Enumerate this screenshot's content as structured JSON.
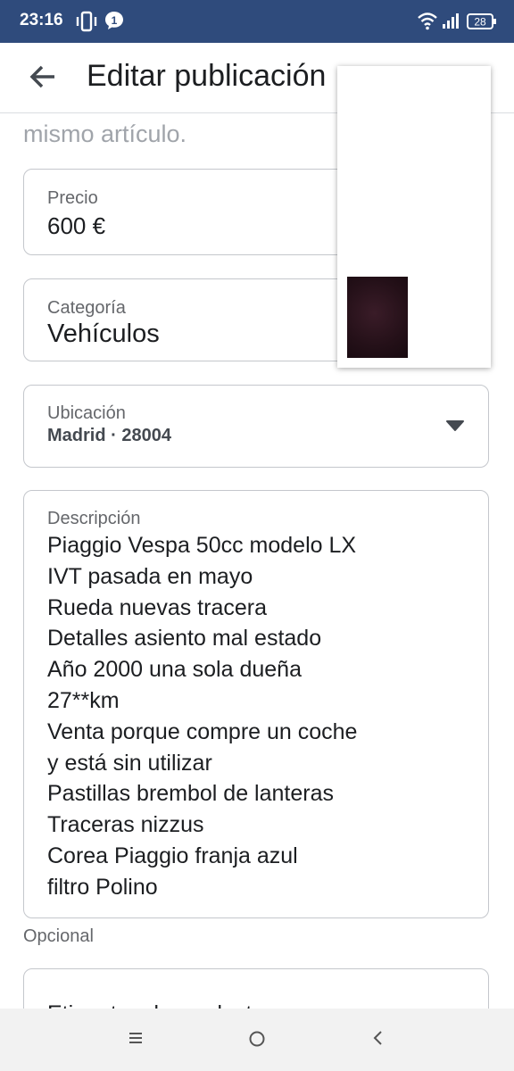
{
  "status_bar": {
    "time": "23:16",
    "battery": "28",
    "background_color": "#2f4b7c",
    "icons": [
      "vibrate-icon",
      "message-notification-icon",
      "wifi-icon",
      "signal-icon",
      "battery-icon"
    ]
  },
  "app_bar": {
    "title": "Editar publicación",
    "back_icon": "arrow-left-icon"
  },
  "form": {
    "hint_text": "mismo artículo.",
    "price": {
      "label": "Precio",
      "value": "600 €"
    },
    "category": {
      "label": "Categoría",
      "value": "Vehículos"
    },
    "location": {
      "label": "Ubicación",
      "value": "Madrid · 28004",
      "icon": "caret-down-icon"
    },
    "description": {
      "label": "Descripción",
      "lines": [
        "Piaggio Vespa 50cc modelo LX",
        "IVT pasada en mayo",
        "Rueda nuevas tracera",
        "Detalles asiento mal estado",
        "Año 2000 una sola dueña",
        "27**km",
        "Venta porque compre un coche",
        "y está sin utilizar",
        "Pastillas brembol de lanteras",
        "Traceras nizzus",
        "Corea Piaggio franja azul",
        "filtro Polino"
      ]
    },
    "optional_label": "Opcional",
    "tags": {
      "label": "Etiquetas de producto"
    }
  },
  "nav_bar": {
    "icons": [
      "menu-icon",
      "home-circle-icon",
      "back-chevron-icon"
    ]
  }
}
